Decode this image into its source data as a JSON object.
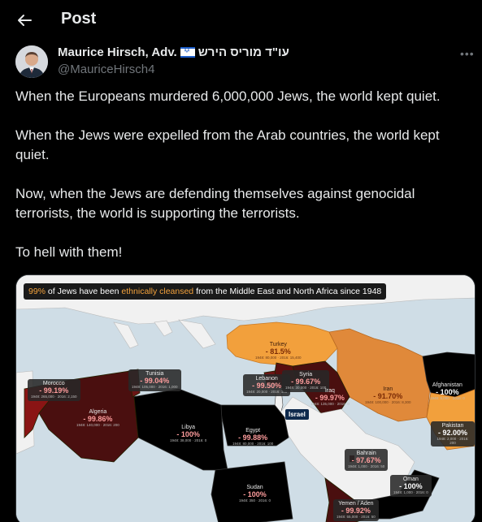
{
  "header": {
    "title": "Post"
  },
  "author": {
    "name": "Maurice Hirsch, Adv.",
    "name_hebrew": "עו\"ד מוריס הירש",
    "handle": "@MauriceHirsch4"
  },
  "post": {
    "paragraphs": [
      "When the Europeans murdered 6,000,000 Jews, the world kept quiet.",
      "When the Jews were expelled from the Arab countries, the world kept quiet.",
      "Now, when the Jews are defending themselves against genocidal terrorists, the world is supporting the terrorists.",
      "To hell with them!"
    ]
  },
  "media": {
    "banner": {
      "pct": "99%",
      "text_a": " of Jews have been ",
      "highlight": "ethnically cleansed",
      "text_b": " from the Middle East and North Africa since 1948"
    },
    "israel_label": "Israel",
    "countries": [
      {
        "name": "Turkey",
        "pct": "- 81.5%",
        "small": "1948: 80,000 · 2016: 15,400"
      },
      {
        "name": "Tunisia",
        "pct": "- 99.04%",
        "small": "1948: 105,000 · 2016: 1,000"
      },
      {
        "name": "Morocco",
        "pct": "- 99.19%",
        "small": "1948: 265,000 · 2016: 2,150"
      },
      {
        "name": "Algeria",
        "pct": "- 99.86%",
        "small": "1948: 140,000 · 2016: 200"
      },
      {
        "name": "Libya",
        "pct": "- 100%",
        "small": "1948: 38,000 · 2016: 0"
      },
      {
        "name": "Egypt",
        "pct": "- 99.88%",
        "small": "1948: 80,000 · 2016: 100"
      },
      {
        "name": "Lebanon",
        "pct": "- 99.50%",
        "small": "1948: 20,000 · 2016: 100"
      },
      {
        "name": "Syria",
        "pct": "- 99.67%",
        "small": "1948: 30,000 · 2016: 100"
      },
      {
        "name": "Iraq",
        "pct": "- 99.97%",
        "small": "1948: 135,000 · 2016: 0"
      },
      {
        "name": "Iran",
        "pct": "- 91.70%",
        "small": "1948: 100,000 · 2016: 8,300"
      },
      {
        "name": "Afghanistan",
        "pct": "- 100%",
        "small": "1948: 5,000 · 2016: 0"
      },
      {
        "name": "Pakistan",
        "pct": "- 92.00%",
        "small": "1948: 2,000 · 2016: 200"
      },
      {
        "name": "Bahrain",
        "pct": "- 97.67%",
        "small": "1948: 1,000 · 2016: 50"
      },
      {
        "name": "Oman",
        "pct": "- 100%",
        "small": "1948: 1,000 · 2016: 0"
      },
      {
        "name": "Sudan",
        "pct": "- 100%",
        "small": "1948: 350 · 2016: 0"
      },
      {
        "name": "Yemen / Aden",
        "pct": "- 99.92%",
        "small": "1948: 55,000 · 2016: 50"
      }
    ]
  },
  "colors": {
    "background": "#000000",
    "text": "#e7e9ea",
    "muted": "#71767b",
    "dark_red": "#4a0f0f",
    "red": "#8a1414",
    "orange": "#e0893a",
    "water": "#cfdde6",
    "land": "#f2f2f2"
  }
}
